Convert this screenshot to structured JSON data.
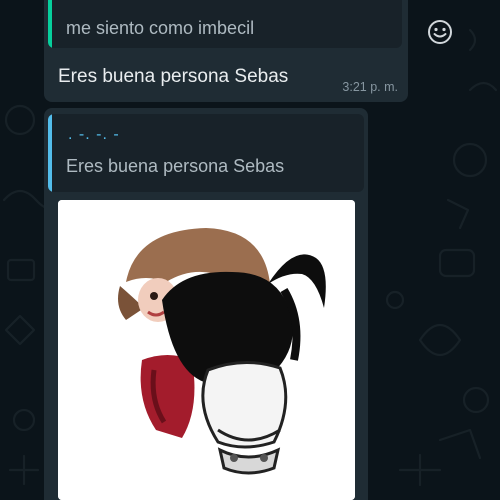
{
  "chat": {
    "messages": [
      {
        "quoted_text": "me siento como imbecil",
        "text": "Eres buena persona Sebas",
        "time": "3:21 p. m."
      },
      {
        "quoted_author": ". -. -. -",
        "quoted_text": "Eres buena persona Sebas",
        "attachment": "sticker"
      }
    ]
  },
  "icons": {
    "reaction": "smiley-icon"
  },
  "colors": {
    "background": "#0b141a",
    "bubble": "#1f2c34",
    "quote_bar_green": "#06cf9c",
    "quote_bar_blue": "#53bdeb",
    "text": "#e9edef",
    "muted": "#8696a0"
  }
}
